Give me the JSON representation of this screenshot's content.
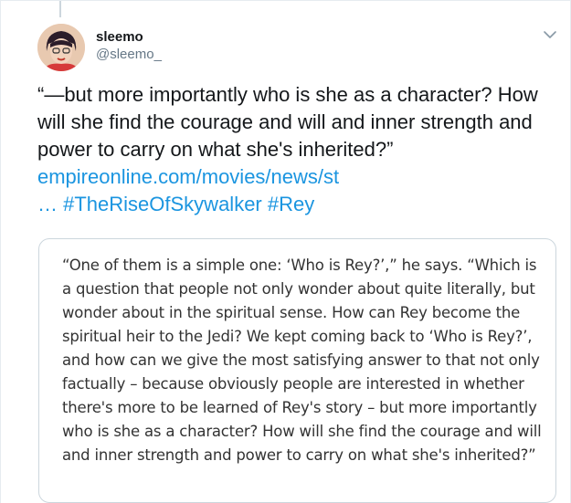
{
  "tweet": {
    "display_name": "sleemo",
    "handle": "@sleemo_",
    "text": "“—but more importantly who is she as a character? How will she find the courage and will and inner strength and power to carry on what she's inherited?”",
    "link_url": "empireonline.com/movies/news/st",
    "link_ellipsis": "…",
    "hashtags": [
      "#TheRiseOfSkywalker",
      "#Rey"
    ]
  },
  "card": {
    "quote": "“One of them is a simple one: ‘Who is Rey?’,” he says. “Which is a question that people not only wonder about quite literally, but wonder about in the spiritual sense. How can Rey become the spiritual heir to the Jedi? We kept coming back to ‘Who is Rey?’, and how can we give the most satisfying answer to that not only factually – because obviously people are interested in whether there's more to be learned of Rey's story – but more importantly who is she as a character? How will she find the courage and will and inner strength and power to carry on what she's inherited?”"
  },
  "icons": {
    "more": "chevron-down-icon"
  },
  "colors": {
    "link": "#1b95e0",
    "secondary_text": "#657786",
    "border": "#ccd6dd"
  }
}
